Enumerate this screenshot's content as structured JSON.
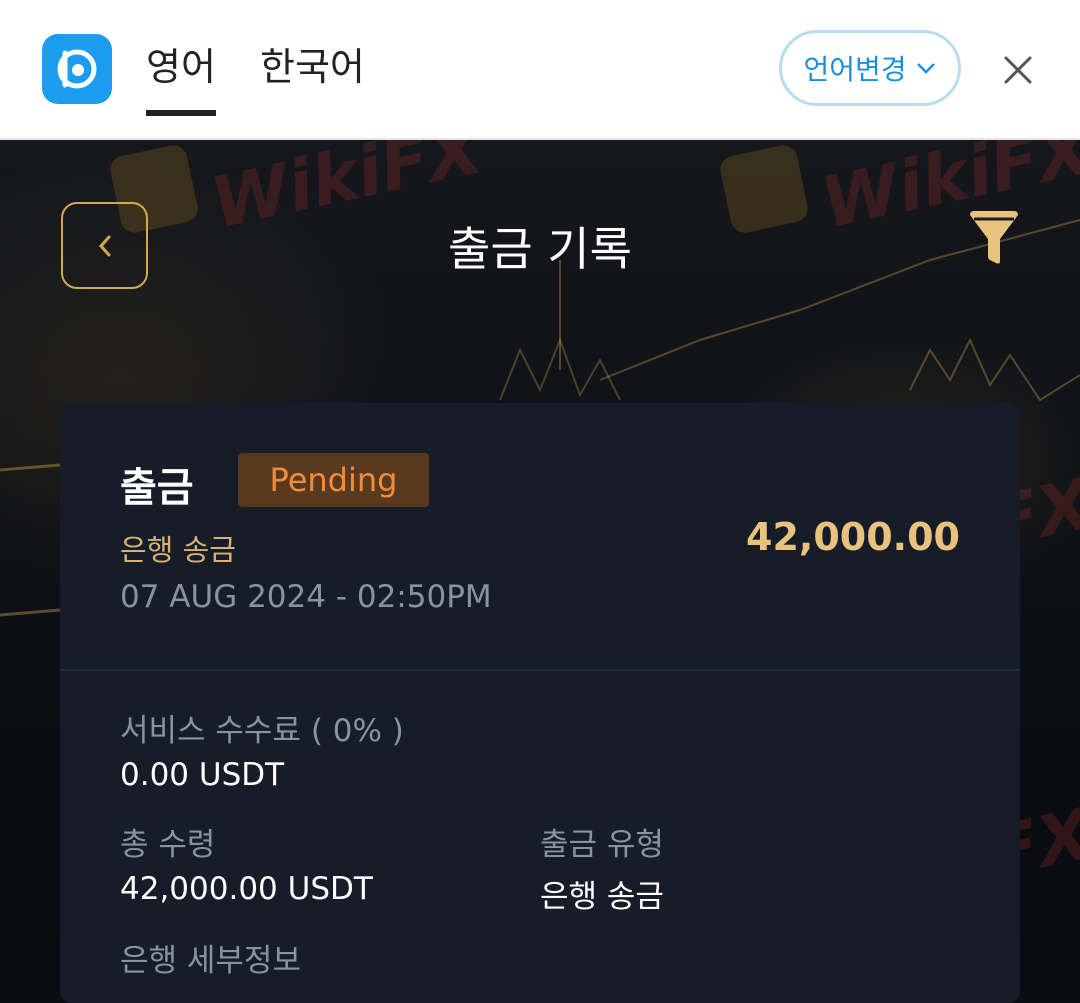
{
  "translate_bar": {
    "tab_active": "영어",
    "tab_other": "한국어",
    "change_language_label": "언어변경"
  },
  "header": {
    "title": "출금 기록"
  },
  "watermark": "WikiFX",
  "record": {
    "type_label": "출금",
    "status": "Pending",
    "method": "은행 송금",
    "datetime": "07 AUG 2024 - 02:50PM",
    "amount": "42,000.00",
    "fee_label": "서비스 수수료 ( 0% )",
    "fee_value": "0.00 USDT",
    "total_label": "총 수령",
    "total_value": "42,000.00 USDT",
    "withdraw_type_label": "출금 유형",
    "withdraw_type_value": "은행 송금",
    "bank_details_label": "은행 세부정보"
  },
  "colors": {
    "accent_gold": "#d4a84f",
    "pending_orange": "#f08c3a",
    "translate_blue": "#1a9cf0"
  }
}
